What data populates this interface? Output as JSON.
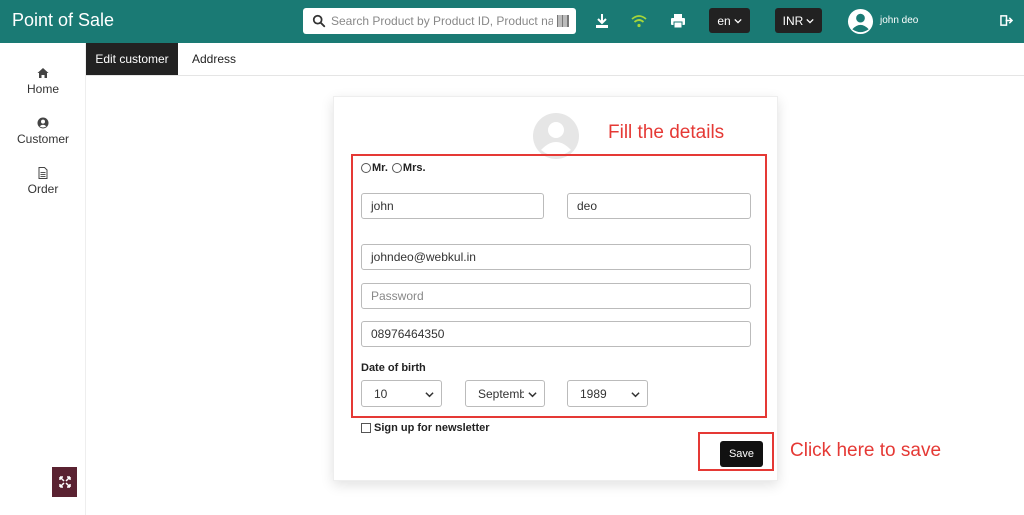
{
  "header": {
    "brand": "Point of Sale",
    "search_placeholder": "Search Product by Product ID, Product name",
    "language": "en",
    "currency": "INR",
    "user_name": "john deo"
  },
  "sidebar": {
    "items": [
      {
        "label": "Home",
        "icon": "home-icon"
      },
      {
        "label": "Customer",
        "icon": "user-circle-icon"
      },
      {
        "label": "Order",
        "icon": "document-icon"
      }
    ]
  },
  "tabs": [
    {
      "label": "Edit customer",
      "active": true
    },
    {
      "label": "Address",
      "active": false
    }
  ],
  "form": {
    "title_options": [
      "Mr.",
      "Mrs."
    ],
    "first_name": "john",
    "last_name": "deo",
    "email": "johndeo@webkul.in",
    "password_placeholder": "Password",
    "phone": "08976464350",
    "dob_label": "Date of birth",
    "dob_day": "10",
    "dob_month": "September",
    "dob_year": "1989",
    "newsletter_label": "Sign up for newsletter",
    "save_label": "Save"
  },
  "annotations": {
    "fill_details": "Fill the details",
    "click_save": "Click here to save"
  },
  "colors": {
    "topbar": "#1a7a74",
    "annotation_red": "#e53935",
    "expand_button": "#5a2231"
  }
}
